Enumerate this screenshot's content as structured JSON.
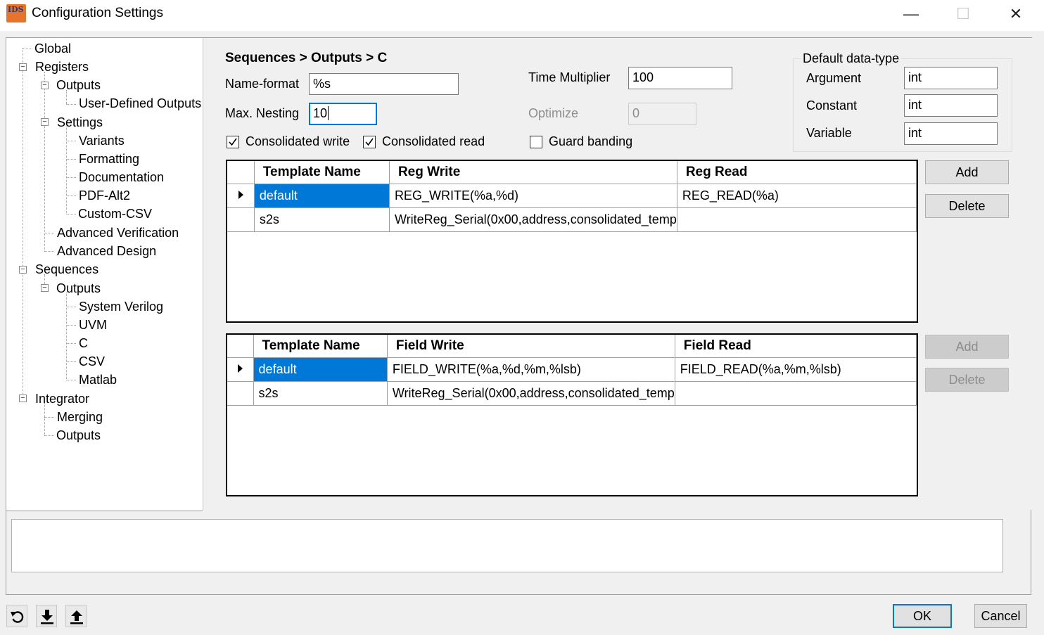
{
  "window": {
    "title": "Configuration Settings",
    "app_icon_text": "IDS",
    "minimize_glyph": "—",
    "maximize_glyph": "☐",
    "close_glyph": "✕"
  },
  "tree": {
    "global": "Global",
    "registers": "Registers",
    "registers_outputs": "Outputs",
    "user_defined_outputs": "User-Defined Outputs",
    "settings": "Settings",
    "variants": "Variants",
    "formatting": "Formatting",
    "documentation": "Documentation",
    "pdf_alt2": "PDF-Alt2",
    "custom_csv": "Custom-CSV",
    "advanced_verification": "Advanced Verification",
    "advanced_design": "Advanced Design",
    "sequences": "Sequences",
    "sequences_outputs": "Outputs",
    "system_verilog": "System Verilog",
    "uvm": "UVM",
    "c": "C",
    "csv": "CSV",
    "matlab": "Matlab",
    "integrator": "Integrator",
    "merging": "Merging",
    "integrator_outputs": "Outputs",
    "collapse_glyph": "−"
  },
  "settings": {
    "breadcrumb": "Sequences > Outputs > C",
    "name_format_label": "Name-format",
    "name_format_value": "%s",
    "max_nesting_label": "Max. Nesting",
    "max_nesting_value": "10",
    "time_multiplier_label": "Time Multiplier",
    "time_multiplier_value": "100",
    "optimize_label": "Optimize",
    "optimize_value": "0",
    "consolidated_write_label": "Consolidated write",
    "consolidated_write_checked": true,
    "consolidated_read_label": "Consolidated read",
    "consolidated_read_checked": true,
    "guard_banding_label": "Guard banding",
    "guard_banding_checked": false
  },
  "default_data_type": {
    "title": "Default data-type",
    "argument_label": "Argument",
    "argument_value": "int",
    "constant_label": "Constant",
    "constant_value": "int",
    "variable_label": "Variable",
    "variable_value": "int"
  },
  "reg_grid": {
    "columns": [
      "Template Name",
      "Reg Write",
      "Reg Read"
    ],
    "rows": [
      [
        "default",
        "REG_WRITE(%a,%d)",
        "REG_READ(%a)"
      ],
      [
        "s2s",
        "WriteReg_Serial(0x00,address,consolidated_temp",
        ""
      ]
    ],
    "add_label": "Add",
    "delete_label": "Delete"
  },
  "field_grid": {
    "columns": [
      "Template Name",
      "Field Write",
      "Field Read"
    ],
    "rows": [
      [
        "default",
        "FIELD_WRITE(%a,%d,%m,%lsb)",
        "FIELD_READ(%a,%m,%lsb)"
      ],
      [
        "s2s",
        "WriteReg_Serial(0x00,address,consolidated_temp",
        ""
      ]
    ],
    "add_label": "Add",
    "delete_label": "Delete"
  },
  "footer": {
    "status_text": "",
    "ok_label": "OK",
    "cancel_label": "Cancel",
    "icons": [
      "reset-icon",
      "import-icon",
      "export-icon"
    ]
  },
  "colors": {
    "selection": "#0078d7",
    "app_icon": "#e8742c"
  }
}
